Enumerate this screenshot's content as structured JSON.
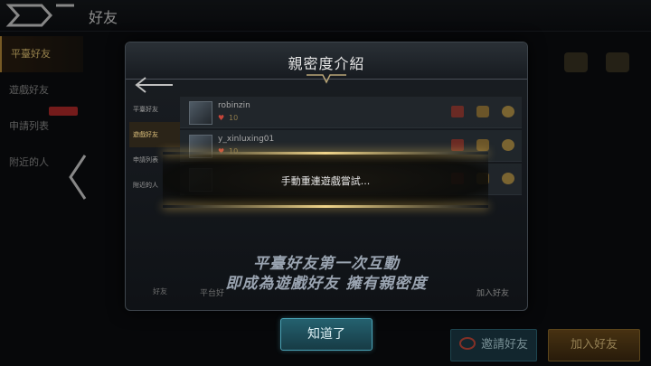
{
  "header": {
    "title": "好友"
  },
  "sidebar": {
    "items": [
      {
        "label": "平臺好友",
        "active": true
      },
      {
        "label": "遊戲好友",
        "active": false
      },
      {
        "label": "申請列表",
        "active": false
      },
      {
        "label": "附近的人",
        "active": false
      }
    ]
  },
  "bottom": {
    "invite_label": "邀請好友",
    "add_label": "加入好友"
  },
  "modal": {
    "title": "親密度介紹",
    "tabs": [
      "平臺好友",
      "遊戲好友",
      "申請列表",
      "附近的人"
    ],
    "rows": [
      {
        "name": "robinzin",
        "intimacy": "10"
      },
      {
        "name": "y_xinluxing01",
        "intimacy": "10"
      },
      {
        "name": "",
        "intimacy": ""
      }
    ],
    "intro_line1": "平臺好友第一次互動",
    "intro_line2": "即成為遊戲好友 擁有親密度",
    "footer_left": "好友",
    "footer_mid": "平台好",
    "footer_right": "加入好友",
    "confirm_label": "知道了"
  },
  "toast": {
    "message": "手動重連遊戲嘗試..."
  },
  "colors": {
    "accent_gold": "#e7c774",
    "confirm_teal": "#24616f",
    "heart_red": "#c7463a"
  }
}
